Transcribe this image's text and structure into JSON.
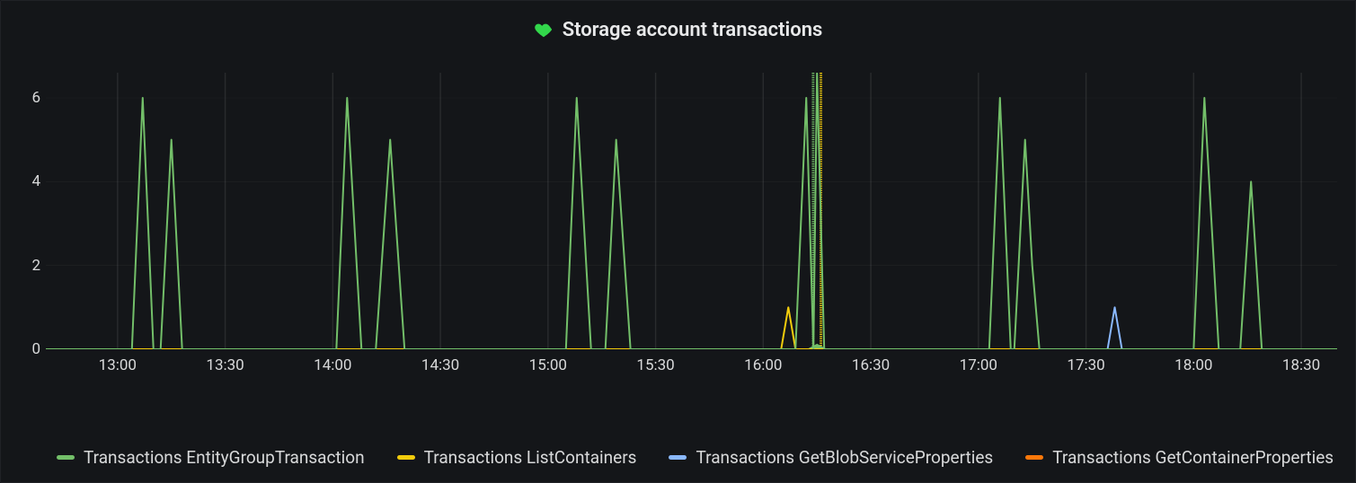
{
  "panel": {
    "title": "Storage account transactions",
    "title_icon": "heart-icon",
    "icon_color": "#32d74b"
  },
  "legend": [
    {
      "label": "Transactions EntityGroupTransaction",
      "color": "#73bf69"
    },
    {
      "label": "Transactions ListContainers",
      "color": "#f2cc0c"
    },
    {
      "label": "Transactions GetBlobServiceProperties",
      "color": "#8ab8ff"
    },
    {
      "label": "Transactions GetContainerProperties",
      "color": "#ff780a"
    }
  ],
  "chart_data": {
    "type": "line",
    "title": "Storage account transactions",
    "xlabel": "",
    "ylabel": "",
    "x_unit": "time_hhmm",
    "x_range": [
      "12:40",
      "18:40"
    ],
    "ylim": [
      0,
      6.6
    ],
    "y_ticks": [
      0,
      2,
      4,
      6
    ],
    "x_ticks": [
      "13:00",
      "13:30",
      "14:00",
      "14:30",
      "15:00",
      "15:30",
      "16:00",
      "16:30",
      "17:00",
      "17:30",
      "18:00",
      "18:30"
    ],
    "grid": {
      "x": true,
      "y": true
    },
    "legend_position": "bottom",
    "annotation": {
      "x": "16:15",
      "color_primary": "#73bf69",
      "color_secondary": "#f2cc0c"
    },
    "series": [
      {
        "name": "Transactions EntityGroupTransaction",
        "color": "#73bf69",
        "points": [
          [
            "12:40",
            0
          ],
          [
            "13:04",
            0
          ],
          [
            "13:07",
            6
          ],
          [
            "13:10",
            0
          ],
          [
            "13:12",
            0
          ],
          [
            "13:15",
            5
          ],
          [
            "13:18",
            0
          ],
          [
            "14:01",
            0
          ],
          [
            "14:04",
            6
          ],
          [
            "14:08",
            0
          ],
          [
            "14:12",
            0
          ],
          [
            "14:16",
            5
          ],
          [
            "14:20",
            0
          ],
          [
            "15:05",
            0
          ],
          [
            "15:08",
            6
          ],
          [
            "15:12",
            0
          ],
          [
            "15:16",
            0
          ],
          [
            "15:19",
            5
          ],
          [
            "15:23",
            0
          ],
          [
            "16:09",
            0
          ],
          [
            "16:12",
            6
          ],
          [
            "16:14",
            0
          ],
          [
            "16:15",
            6.6
          ],
          [
            "16:17",
            0
          ],
          [
            "17:03",
            0
          ],
          [
            "17:06",
            6
          ],
          [
            "17:09",
            0
          ],
          [
            "17:10",
            0
          ],
          [
            "17:13",
            5
          ],
          [
            "17:15",
            2
          ],
          [
            "17:17",
            0
          ],
          [
            "18:00",
            0
          ],
          [
            "18:03",
            6
          ],
          [
            "18:07",
            0
          ],
          [
            "18:13",
            0
          ],
          [
            "18:16",
            4
          ],
          [
            "18:19",
            0
          ],
          [
            "18:40",
            0
          ]
        ]
      },
      {
        "name": "Transactions ListContainers",
        "color": "#f2cc0c",
        "points": [
          [
            "12:40",
            0
          ],
          [
            "16:05",
            0
          ],
          [
            "16:07",
            1
          ],
          [
            "16:09",
            0
          ],
          [
            "18:40",
            0
          ]
        ]
      },
      {
        "name": "Transactions GetBlobServiceProperties",
        "color": "#8ab8ff",
        "points": [
          [
            "12:40",
            0
          ],
          [
            "17:36",
            0
          ],
          [
            "17:38",
            1
          ],
          [
            "17:40",
            0
          ],
          [
            "18:40",
            0
          ]
        ]
      },
      {
        "name": "Transactions GetContainerProperties",
        "color": "#ff780a",
        "points": [
          [
            "12:40",
            0
          ],
          [
            "18:40",
            0
          ]
        ]
      }
    ]
  }
}
